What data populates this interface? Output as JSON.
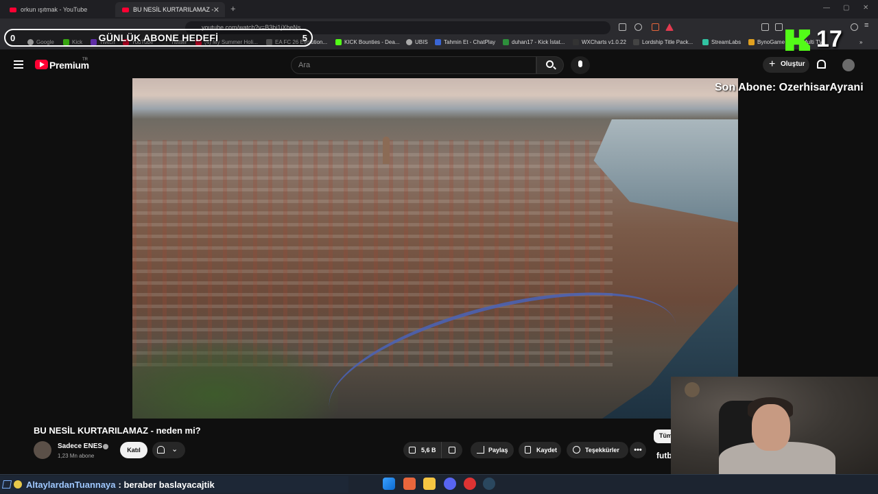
{
  "browser": {
    "tabs": [
      {
        "title": "orkun ışıtmak - YouTube"
      },
      {
        "title": "BU NESİL KURTARILAMAZ - ned"
      }
    ],
    "url": "youtube.com/watch?v=B3bi1jXheNs",
    "bookmarks": [
      "Google",
      "Kick",
      "Twitch",
      "YouTube",
      "Twitter",
      "(4) My Summer Holi...",
      "EA FC 26 Evolution...",
      "KICK Bounties - Dea...",
      "UBIS",
      "Tahmin Et - ChatPlay",
      "duhan17 - Kick İstat...",
      "WXCharts v1.0.22",
      "Lordship Title Pack...",
      "StreamLabs",
      "BynoGame",
      "Multi TV"
    ]
  },
  "overlay": {
    "goal_title": "GÜNLÜK ABONE HEDEFİ",
    "goal_current": "0",
    "goal_target": "5",
    "last_sub": "Son Abone: OzerhisarAyrani",
    "kick_count": "17"
  },
  "youtube": {
    "brand": "Premium",
    "country": "TR",
    "search_placeholder": "Ara",
    "create_label": "Oluştur"
  },
  "video": {
    "title": "BU NESİL KURTARILAMAZ - neden mi?",
    "channel": "Sadece ENES",
    "subscribers": "1,23 Mn abone",
    "join_label": "Katıl",
    "likes": "5,6 B",
    "share_label": "Paylaş",
    "save_label": "Kaydet",
    "thanks_label": "Teşekkürler",
    "more_label": "•••",
    "side_chip": "Tüm",
    "side_label": "futb"
  },
  "chat": {
    "user": "AltaylardanTuannaya",
    "message": ": beraber baslayacajtik"
  },
  "colors": {
    "youtube_red": "#ff0033",
    "kick_green": "#53fc18",
    "chat_user": "#9fc8ff"
  }
}
